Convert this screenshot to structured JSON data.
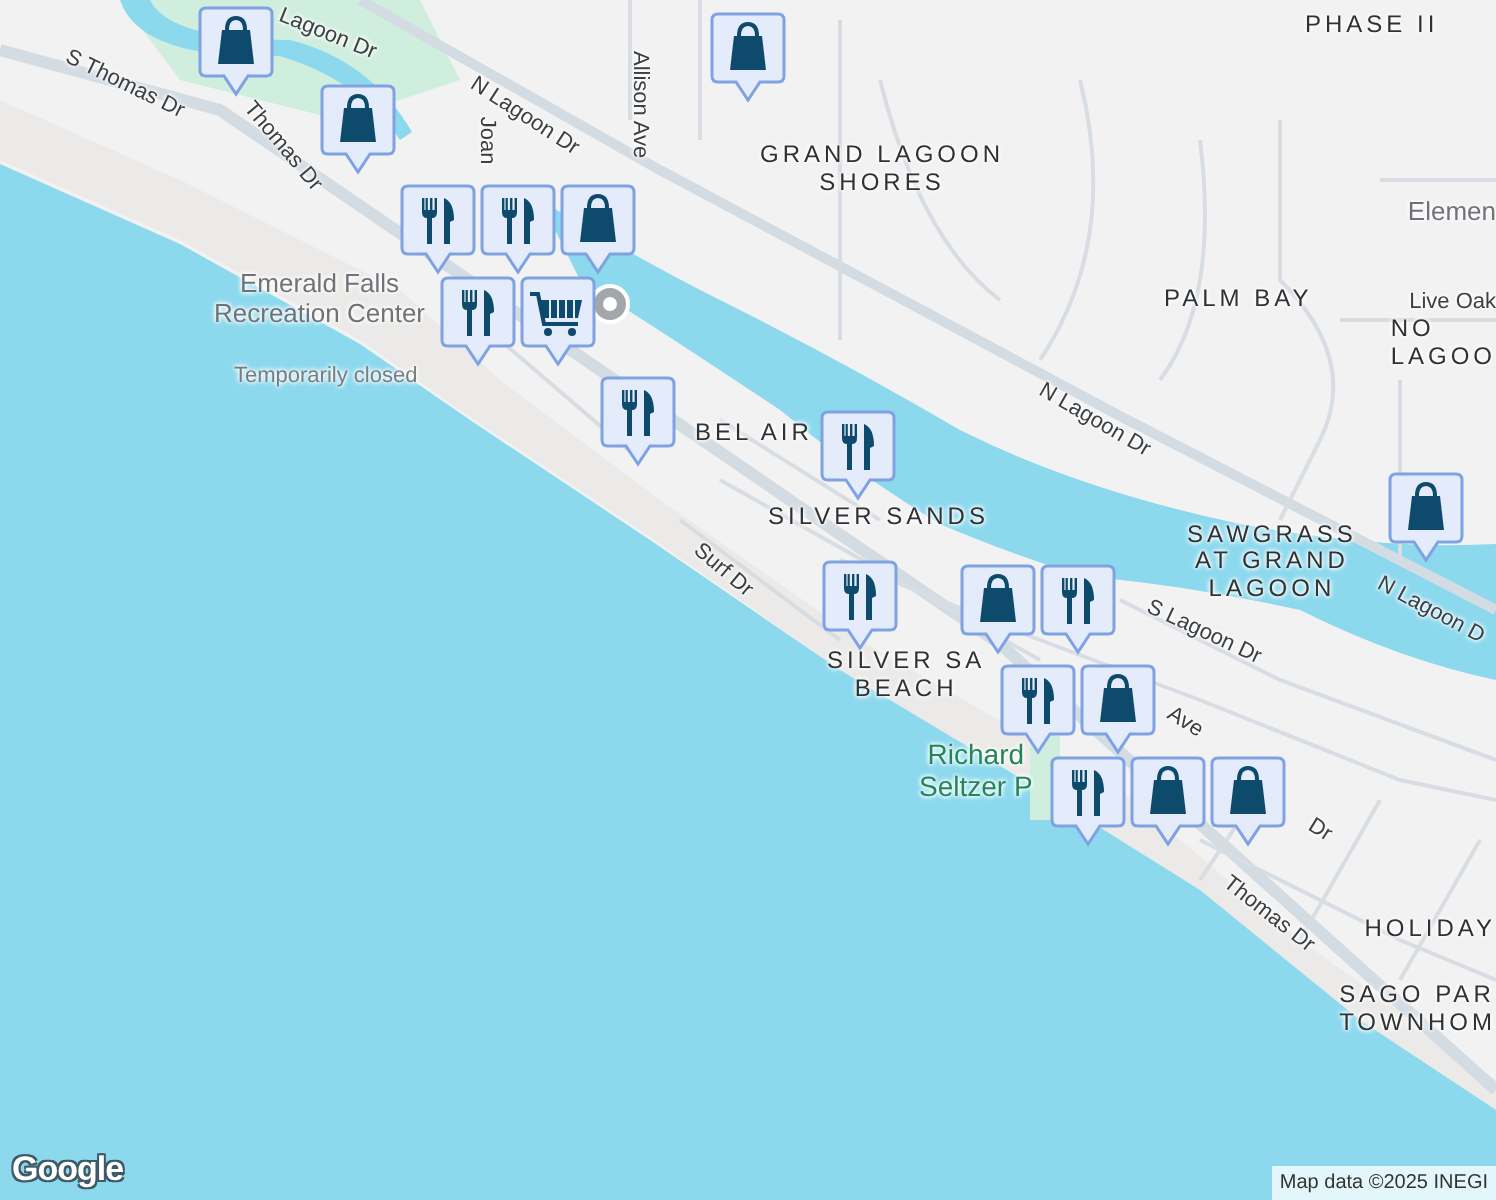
{
  "map": {
    "labels": [
      {
        "kind": "road",
        "lines": [
          "Lagoon Dr"
        ]
      },
      {
        "kind": "road",
        "lines": [
          "S Thomas Dr"
        ]
      },
      {
        "kind": "road",
        "lines": [
          "Thomas Dr"
        ]
      },
      {
        "kind": "road",
        "lines": [
          "N Lagoon Dr"
        ]
      },
      {
        "kind": "road",
        "lines": [
          "Allison Ave"
        ]
      },
      {
        "kind": "road",
        "lines": [
          "Joan"
        ]
      },
      {
        "kind": "area",
        "lines": [
          "GRAND LAGOON",
          "SHORES"
        ]
      },
      {
        "kind": "area",
        "lines": [
          "PHASE II"
        ]
      },
      {
        "kind": "poi",
        "lines": [
          "Elemen"
        ]
      },
      {
        "kind": "road",
        "lines": [
          "Live Oak"
        ]
      },
      {
        "kind": "area",
        "lines": [
          "NO",
          "LAGOO"
        ]
      },
      {
        "kind": "area",
        "lines": [
          "PALM BAY"
        ]
      },
      {
        "kind": "road",
        "lines": [
          "N Lagoon Dr"
        ]
      },
      {
        "kind": "area",
        "lines": [
          "BEL AIR"
        ]
      },
      {
        "kind": "area",
        "lines": [
          "SILVER SANDS"
        ]
      },
      {
        "kind": "area",
        "lines": [
          "SAWGRASS",
          "AT GRAND",
          "LAGOON"
        ]
      },
      {
        "kind": "road",
        "lines": [
          "N Lagoon D"
        ]
      },
      {
        "kind": "road",
        "lines": [
          "Surf Dr"
        ]
      },
      {
        "kind": "area",
        "lines": [
          "SILVER SA",
          "BEACH"
        ]
      },
      {
        "kind": "road",
        "lines": [
          "S Lagoon Dr"
        ]
      },
      {
        "kind": "road",
        "lines": [
          "Ave"
        ]
      },
      {
        "kind": "road",
        "lines": [
          "Dr"
        ]
      },
      {
        "kind": "park",
        "lines": [
          "Richard",
          "Seltzer P"
        ]
      },
      {
        "kind": "road",
        "lines": [
          "Thomas Dr"
        ]
      },
      {
        "kind": "area",
        "lines": [
          "HOLIDAY"
        ]
      },
      {
        "kind": "area",
        "lines": [
          "SAGO PAR",
          "TOWNHOM"
        ]
      },
      {
        "kind": "poi",
        "lines": [
          "Emerald Falls",
          "Recreation Center"
        ]
      },
      {
        "kind": "note",
        "lines": [
          "Temporarily closed"
        ]
      }
    ],
    "markers": [
      {
        "kind": "shopping"
      },
      {
        "kind": "shopping"
      },
      {
        "kind": "restaurant"
      },
      {
        "kind": "restaurant"
      },
      {
        "kind": "shopping"
      },
      {
        "kind": "restaurant"
      },
      {
        "kind": "grocery"
      },
      {
        "kind": "restaurant"
      },
      {
        "kind": "shopping"
      },
      {
        "kind": "restaurant"
      },
      {
        "kind": "restaurant"
      },
      {
        "kind": "shopping"
      },
      {
        "kind": "restaurant"
      },
      {
        "kind": "restaurant"
      },
      {
        "kind": "shopping"
      },
      {
        "kind": "restaurant"
      },
      {
        "kind": "shopping"
      },
      {
        "kind": "shopping"
      },
      {
        "kind": "shopping"
      }
    ],
    "attribution": "Map data ©2025 INEGI",
    "logo": "Google"
  }
}
